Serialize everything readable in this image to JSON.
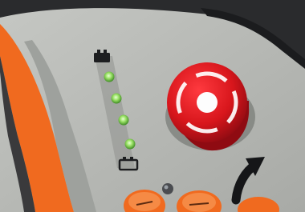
{
  "photo": {
    "subject": "machine-control-panel",
    "colors": {
      "panel": "#b9bbb8",
      "panel_shadow": "#9ea19d",
      "housing": "#2a2b2d",
      "orange": "#f06a1f",
      "stop_red": "#d8161c",
      "stop_ring": "#8f0b12",
      "led_green": "#7cd64a",
      "background_sky": "#9fe6ea"
    },
    "battery_indicator": {
      "led_count": 4,
      "leds_lit": 4,
      "top_icon": "battery-full-icon",
      "bottom_icon": "battery-empty-icon"
    },
    "emergency_stop": {
      "icon": "emergency-stop-icon"
    },
    "indicator_light": {
      "state": "off"
    },
    "arrow": {
      "icon": "curved-arrow-up-icon"
    },
    "keys": [
      {
        "icon": "orange-key-icon"
      },
      {
        "icon": "orange-key-icon"
      },
      {
        "icon": "orange-key-icon"
      }
    ]
  }
}
